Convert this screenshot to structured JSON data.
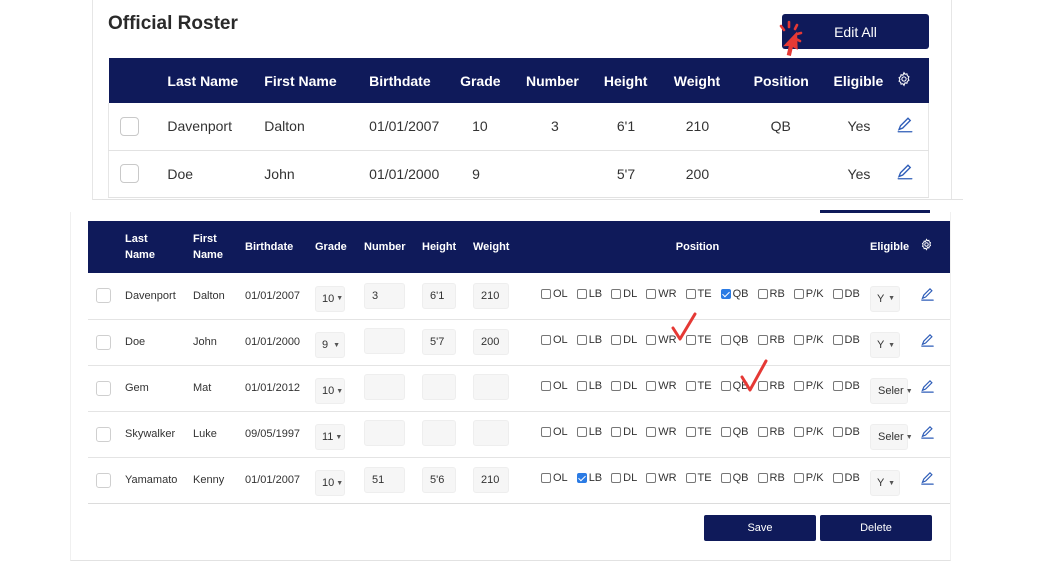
{
  "top": {
    "title": "Official Roster",
    "edit_all_label": "Edit All",
    "columns": [
      "Last Name",
      "First Name",
      "Birthdate",
      "Grade",
      "Number",
      "Height",
      "Weight",
      "Position",
      "Eligible"
    ],
    "rows": [
      {
        "last": "Davenport",
        "first": "Dalton",
        "birth": "01/01/2007",
        "grade": "10",
        "number": "3",
        "height": "6'1",
        "weight": "210",
        "position": "QB",
        "eligible": "Yes"
      },
      {
        "last": "Doe",
        "first": "John",
        "birth": "01/01/2000",
        "grade": "9",
        "number": "",
        "height": "5'7",
        "weight": "200",
        "position": "",
        "eligible": "Yes"
      }
    ]
  },
  "grid": {
    "columns": {
      "last": "Last Name",
      "first": "First Name",
      "birth": "Birthdate",
      "grade": "Grade",
      "number": "Number",
      "height": "Height",
      "weight": "Weight",
      "position": "Position",
      "eligible": "Eligible"
    },
    "positions": [
      "OL",
      "LB",
      "DL",
      "WR",
      "TE",
      "QB",
      "RB",
      "P/K",
      "DB"
    ],
    "rows": [
      {
        "last": "Davenport",
        "first": "Dalton",
        "birth": "01/01/2007",
        "grade": "10",
        "number": "3",
        "height": "6'1",
        "weight": "210",
        "checked": [
          "QB"
        ],
        "eligible": "Y"
      },
      {
        "last": "Doe",
        "first": "John",
        "birth": "01/01/2000",
        "grade": "9",
        "number": "",
        "height": "5'7",
        "weight": "200",
        "checked": [],
        "eligible": "Y"
      },
      {
        "last": "Gem",
        "first": "Mat",
        "birth": "01/01/2012",
        "grade": "10",
        "number": "",
        "height": "",
        "weight": "",
        "checked": [],
        "eligible": "Seler"
      },
      {
        "last": "Skywalker",
        "first": "Luke",
        "birth": "09/05/1997",
        "grade": "11",
        "number": "",
        "height": "",
        "weight": "",
        "checked": [],
        "eligible": "Seler"
      },
      {
        "last": "Yamamato",
        "first": "Kenny",
        "birth": "01/01/2007",
        "grade": "10",
        "number": "51",
        "height": "5'6",
        "weight": "210",
        "checked": [
          "LB"
        ],
        "eligible": "Y"
      }
    ]
  },
  "actions": {
    "save_label": "Save",
    "delete_label": "Delete"
  },
  "colors": {
    "header_navy": "#0f1a5a",
    "checkbox_blue": "#2b7be4",
    "annotation_red": "#e53935",
    "pencil_blue": "#2e5db8"
  },
  "icons": {
    "settings": "gear-icon",
    "edit": "pencil-icon",
    "click": "cursor-click-icon"
  }
}
